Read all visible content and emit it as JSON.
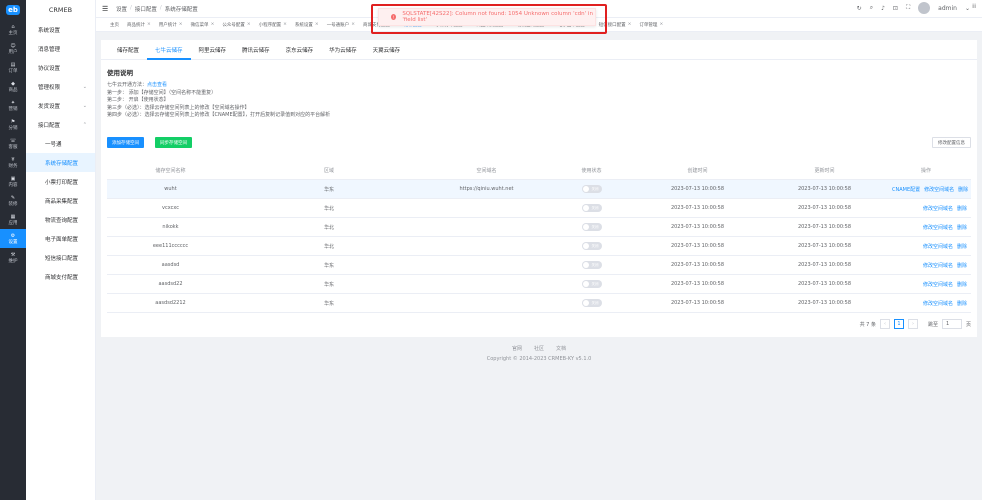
{
  "rail": {
    "logo": "eb",
    "items": [
      {
        "label": "主页",
        "icon": "home-icon"
      },
      {
        "label": "用户",
        "icon": "user-icon"
      },
      {
        "label": "订单",
        "icon": "order-icon"
      },
      {
        "label": "商品",
        "icon": "product-icon"
      },
      {
        "label": "营销",
        "icon": "marketing-icon"
      },
      {
        "label": "分销",
        "icon": "distribution-icon"
      },
      {
        "label": "客服",
        "icon": "service-icon"
      },
      {
        "label": "财务",
        "icon": "finance-icon"
      },
      {
        "label": "内容",
        "icon": "content-icon"
      },
      {
        "label": "装修",
        "icon": "decorate-icon"
      },
      {
        "label": "应用",
        "icon": "app-icon"
      },
      {
        "label": "设置",
        "icon": "settings-icon",
        "active": true
      },
      {
        "label": "维护",
        "icon": "maintain-icon"
      }
    ]
  },
  "sidebar": {
    "brand": "CRMEB",
    "items": [
      {
        "label": "系统设置"
      },
      {
        "label": "消息管理"
      },
      {
        "label": "协议设置"
      },
      {
        "label": "管理权限",
        "caret": "⌄"
      },
      {
        "label": "发货设置",
        "caret": "⌄"
      },
      {
        "label": "接口配置",
        "caret": "⌃"
      },
      {
        "label": "一号通",
        "sub": true
      },
      {
        "label": "系统存储配置",
        "sub": true,
        "active": true
      },
      {
        "label": "小票打印配置",
        "sub": true
      },
      {
        "label": "商品采集配置",
        "sub": true
      },
      {
        "label": "物流查询配置",
        "sub": true
      },
      {
        "label": "电子面单配置",
        "sub": true
      },
      {
        "label": "短信接口配置",
        "sub": true
      },
      {
        "label": "商城支付配置",
        "sub": true
      }
    ]
  },
  "header": {
    "breadcrumb": [
      "设置",
      "接口配置",
      "系统存储配置"
    ],
    "user": "admin"
  },
  "tags": [
    {
      "label": "主页"
    },
    {
      "label": "商品统计"
    },
    {
      "label": "用户统计"
    },
    {
      "label": "微信菜单"
    },
    {
      "label": "公众号配置"
    },
    {
      "label": "小程序配置"
    },
    {
      "label": "系统设置"
    },
    {
      "label": "一号通账户"
    },
    {
      "label": "商城支付配置"
    },
    {
      "label": "储存配置",
      "active": true
    },
    {
      "label": "小票打印配置"
    },
    {
      "label": "商品采集配置"
    },
    {
      "label": "物流查询配置"
    },
    {
      "label": "电子面单配置"
    },
    {
      "label": "短信接口配置"
    },
    {
      "label": "订单管理"
    }
  ],
  "toast": {
    "message": "SQLSTATE[42S22]: Column not found: 1054 Unknown column 'cdn' in 'field list'"
  },
  "tabs": [
    "储存配置",
    "七牛云储存",
    "阿里云储存",
    "腾讯云储存",
    "京东云储存",
    "华为云储存",
    "天翼云储存"
  ],
  "active_tab": 1,
  "usage": {
    "title": "使用说明",
    "line0_prefix": "七牛云开通方法：",
    "line0_link": "点击查看",
    "lines": [
      "第一步：  添加【存储空间】（空间名称不能重复）",
      "第二步：  开启【使用状态】",
      "第三步（必选）：选择云存储空间列表上的修改【空间域名操作】",
      "第四步（必选）：选择云存储空间列表上的修改【CNAME配置】，打开后复制记录值到对应的平台解析"
    ]
  },
  "buttons": {
    "add_space": "添加存储空间",
    "sync_space": "同步存储空间",
    "modify_config": "修改配置信息"
  },
  "table": {
    "headers": [
      "储存空间名称",
      "区域",
      "空间域名",
      "使用状态",
      "创建时间",
      "更新时间",
      "操作"
    ],
    "switch_off": "关闭",
    "rows": [
      {
        "name": "wuht",
        "region": "华东",
        "domain": "https://qiniu.wuht.net",
        "created": "2023-07-13 10:00:58",
        "updated": "2023-07-13 10:00:58",
        "ops": [
          "CNAME配置",
          "修改空间域名",
          "删除"
        ]
      },
      {
        "name": "vcxcxc",
        "region": "华北",
        "domain": "",
        "created": "2023-07-13 10:00:58",
        "updated": "2023-07-13 10:00:58",
        "ops": [
          "修改空间域名",
          "删除"
        ]
      },
      {
        "name": "nikokk",
        "region": "华北",
        "domain": "",
        "created": "2023-07-13 10:00:58",
        "updated": "2023-07-13 10:00:58",
        "ops": [
          "修改空间域名",
          "删除"
        ]
      },
      {
        "name": "eee111cccccc",
        "region": "华北",
        "domain": "",
        "created": "2023-07-13 10:00:58",
        "updated": "2023-07-13 10:00:58",
        "ops": [
          "修改空间域名",
          "删除"
        ]
      },
      {
        "name": "aasdsd",
        "region": "华东",
        "domain": "",
        "created": "2023-07-13 10:00:58",
        "updated": "2023-07-13 10:00:58",
        "ops": [
          "修改空间域名",
          "删除"
        ]
      },
      {
        "name": "aasdsd22",
        "region": "华东",
        "domain": "",
        "created": "2023-07-13 10:00:58",
        "updated": "2023-07-13 10:00:58",
        "ops": [
          "修改空间域名",
          "删除"
        ]
      },
      {
        "name": "aasdsd2212",
        "region": "华东",
        "domain": "",
        "created": "2023-07-13 10:00:58",
        "updated": "2023-07-13 10:00:58",
        "ops": [
          "修改空间域名",
          "删除"
        ]
      }
    ]
  },
  "pagination": {
    "total": "共 7 条",
    "page": "1",
    "goto": "跳至",
    "goto_value": "1",
    "unit": "页"
  },
  "footer": {
    "links": [
      "官网",
      "社区",
      "文档"
    ],
    "copyright": "Copyright © 2014-2023 CRMEB-KY v5.1.0"
  }
}
